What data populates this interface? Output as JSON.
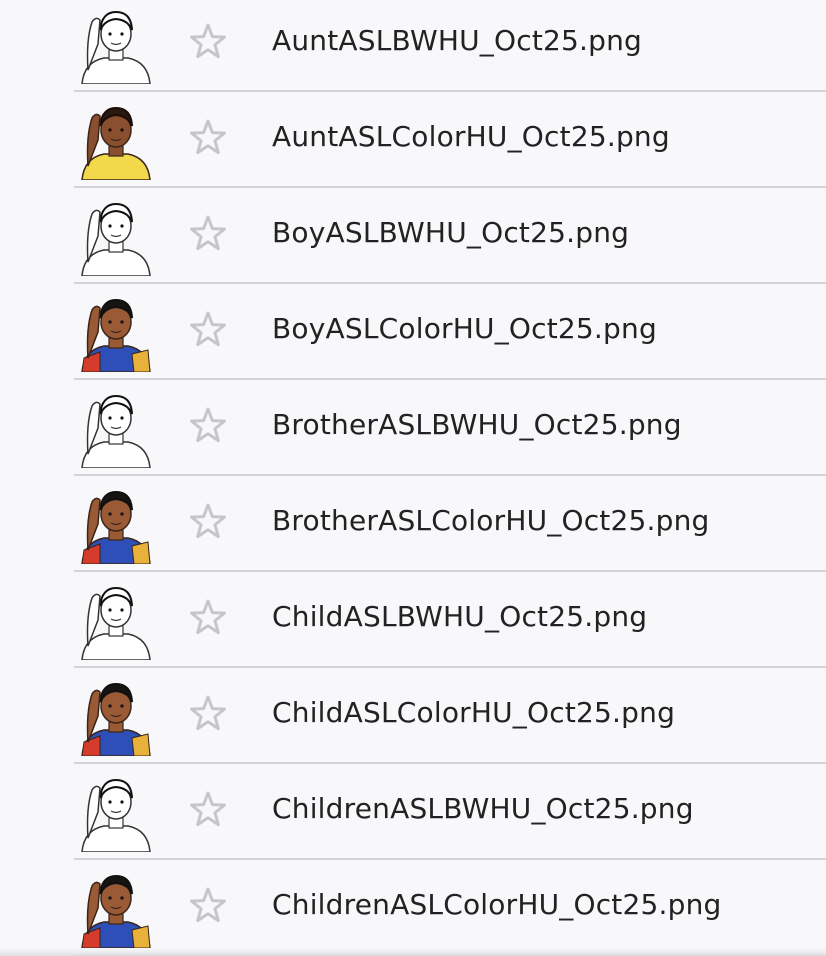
{
  "colors": {
    "background": "#f8f8fa",
    "divider": "#d3d3d6",
    "star_outline": "#c6c6cc",
    "text": "#222222"
  },
  "files": [
    {
      "name": "AuntASLBWHU_Oct25.png",
      "icon": "aunt-sign-bw-thumbnail-icon",
      "color": false,
      "starred": false
    },
    {
      "name": "AuntASLColorHU_Oct25.png",
      "icon": "aunt-sign-color-thumbnail-icon",
      "color": true,
      "starred": false
    },
    {
      "name": "BoyASLBWHU_Oct25.png",
      "icon": "boy-sign-bw-thumbnail-icon",
      "color": false,
      "starred": false
    },
    {
      "name": "BoyASLColorHU_Oct25.png",
      "icon": "boy-sign-color-thumbnail-icon",
      "color": true,
      "starred": false
    },
    {
      "name": "BrotherASLBWHU_Oct25.png",
      "icon": "brother-sign-bw-thumbnail-icon",
      "color": false,
      "starred": false
    },
    {
      "name": "BrotherASLColorHU_Oct25.png",
      "icon": "brother-sign-color-thumbnail-icon",
      "color": true,
      "starred": false
    },
    {
      "name": "ChildASLBWHU_Oct25.png",
      "icon": "child-sign-bw-thumbnail-icon",
      "color": false,
      "starred": false
    },
    {
      "name": "ChildASLColorHU_Oct25.png",
      "icon": "child-sign-color-thumbnail-icon",
      "color": true,
      "starred": false
    },
    {
      "name": "ChildrenASLBWHU_Oct25.png",
      "icon": "children-sign-bw-thumbnail-icon",
      "color": false,
      "starred": false
    },
    {
      "name": "ChildrenASLColorHU_Oct25.png",
      "icon": "children-sign-color-thumbnail-icon",
      "color": true,
      "starred": false
    }
  ]
}
